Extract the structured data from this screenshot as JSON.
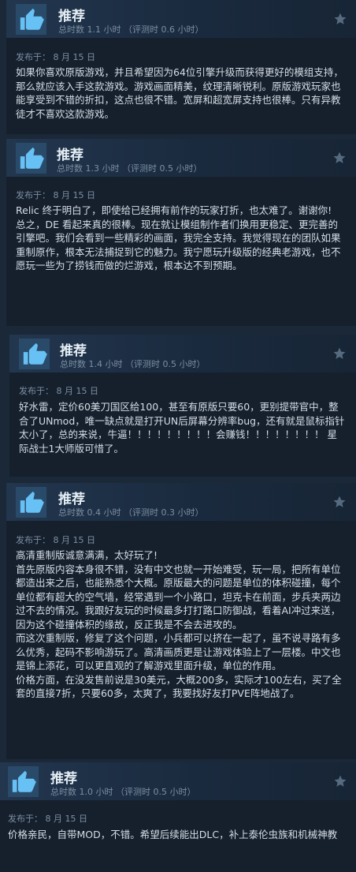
{
  "reviews": [
    {
      "recommendation": "推荐",
      "hours": "总时数 1.1 小时  （评测时 0.6 小时）",
      "posted": "发布于： 8 月 15 日",
      "paragraphs": [
        "如果你喜欢原版游戏，并且希望因为64位引擎升级而获得更好的模组支持，那么就应该入手这款游戏。游戏画面精美，纹理清晰锐利。原版游戏玩家也能享受到不错的折扣，这点也很不错。宽屏和超宽屏支持也很棒。只有异教徒才不喜欢这款游戏。"
      ]
    },
    {
      "recommendation": "推荐",
      "hours": "总时数 1.3 小时  （评测时 0.5 小时）",
      "posted": "发布于： 8 月 15 日",
      "paragraphs": [
        "Relic 终于明白了，即使给已经拥有前作的玩家打折，也太难了。谢谢你!",
        "总之，DE 看起来真的很棒。现在就让模组制作者们换用更稳定、更完善的引擎吧。我们会看到一些精彩的画面，我完全支持。我觉得现在的团队如果重制原作，根本无法捕捉到它的魅力。我宁愿玩升级版的经典老游戏，也不愿玩一些为了捞钱而做的烂游戏，根本达不到预期。"
      ]
    },
    {
      "recommendation": "推荐",
      "hours": "总时数 1.4 小时  （评测时 0.5 小时）",
      "posted": "发布于： 8 月 15 日",
      "paragraphs": [
        "好水雷，定价60美刀国区给100，甚至有原版只要60，更别提带官中，整合了UNmod，唯一缺点就是打开UN后屏幕分辨率bug，还有就是鼠标指针太小了，总的来说，牛逼！！！！！！！！！会赚钱！！！！！！！！ 星际战士1大师版可惜了。"
      ]
    },
    {
      "recommendation": "推荐",
      "hours": "总时数 0.4 小时  （评测时 0.3 小时）",
      "posted": "发布于： 8 月 15 日",
      "paragraphs": [
        "高清重制版诚意满满，太好玩了!",
        "首先原版内容本身很不错，没有中文也就一开始难受，玩一局，把所有单位都造出来之后，也能熟悉个大概。原版最大的问题是单位的体积碰撞，每个单位都有超大的空气墙，经常遇到一个小路口，坦克卡在前面，步兵夹两边过不去的情况。我跟好友玩的时候最多打打路口防御战，看着AI冲过来送，因为这个碰撞体积的缘故，反正我是不会去进攻的。",
        "而这次重制版，修复了这个问题，小兵都可以挤在一起了，虽不说寻路有多么优秀，起码不影响游玩了。高清画质更是让游戏体验上了一层楼。中文也是锦上添花，可以更直观的了解游戏里面升级，单位的作用。",
        "价格方面，在没发售前说是30美元，大概200多，实际才100左右，买了全套的直接7折，只要60多，太爽了，我要找好友打PVE阵地战了。"
      ]
    },
    {
      "recommendation": "推荐",
      "hours": "总时数 1.0 小时  （评测时 0.5 小时）",
      "posted": "发布于： 8 月 15 日",
      "paragraphs": [
        "价格亲民，自带MOD，不错。希望后续能出DLC，补上泰伦虫族和机械神教"
      ]
    }
  ],
  "icons": {
    "recommend": "thumbs-up-icon",
    "award": "star-icon"
  },
  "colors": {
    "page_bg": "#1b2838",
    "card_bg": "#16202d",
    "thumb_bg": "#2a4a6a",
    "thumb_icon": "#67c1f5",
    "muted_text": "#7b8fa2"
  }
}
